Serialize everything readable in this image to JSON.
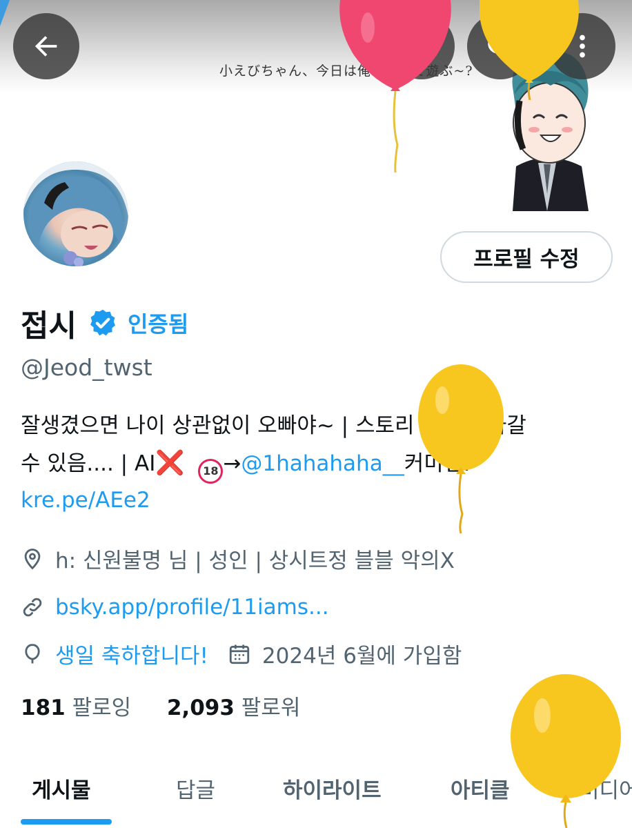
{
  "banner": {
    "caption": "小えびちゃん、今日は俺と何して遊ぶ~?"
  },
  "topbar": {
    "back_icon": "arrow-left-icon",
    "x_icon": "x-logo-icon",
    "search_icon": "search-icon",
    "more_icon": "more-vertical-icon"
  },
  "profile": {
    "edit_button": "프로필 수정",
    "display_name": "접시",
    "verified_label": "인증됨",
    "handle": "@Jeod_twst",
    "bio": {
      "line1": "잘생겼으면 나이 상관없이 오빠야~ | 스토리 스포 올라갈",
      "line2_a": "수 있음.... | AI",
      "line2_cross": "❌",
      "line2_badge": "18",
      "line2_arrow": "→",
      "line2_mention": "@1hahahaha__",
      "line2_b": "커미션:",
      "line3_link": "kre.pe/AEe2"
    },
    "location": "h: 신원불명 님 | 성인 | 상시트정 블블 악의X",
    "website": "bsky.app/profile/11iams...",
    "birthday": "생일 축하합니다!",
    "joined": "2024년 6월에 가입함",
    "following_count": "181",
    "following_label": "팔로잉",
    "followers_count": "2,093",
    "followers_label": "팔로워"
  },
  "tabs": [
    {
      "label": "게시물",
      "active": true
    },
    {
      "label": "답글",
      "active": false
    },
    {
      "label": "하이라이트",
      "active": false
    },
    {
      "label": "아티클",
      "active": false
    },
    {
      "label": "미디어",
      "active": false
    }
  ],
  "colors": {
    "accent": "#1d9bf0",
    "text": "#0f1419",
    "muted": "#536471",
    "balloon_red": "#ef476f",
    "balloon_yellow": "#f7c71f"
  }
}
